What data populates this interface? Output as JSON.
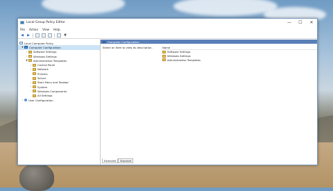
{
  "window": {
    "title": "Local Group Policy Editor",
    "controls": {
      "minimize": "—",
      "maximize": "☐",
      "close": "✕"
    }
  },
  "menu": [
    "File",
    "Action",
    "View",
    "Help"
  ],
  "toolbar": [
    "back",
    "forward",
    "up",
    "show-hide-tree",
    "properties",
    "help",
    "filter"
  ],
  "tree": {
    "root": "Local Computer Policy",
    "computer_config": "Computer Configuration",
    "software_settings": "Software Settings",
    "windows_settings": "Windows Settings",
    "admin_templates": "Administrative Templates",
    "control_panel": "Control Panel",
    "network": "Network",
    "printers": "Printers",
    "server": "Server",
    "start_menu": "Start Menu and Taskbar",
    "system": "System",
    "windows_components": "Windows Components",
    "all_settings": "All Settings",
    "user_config": "User Configuration"
  },
  "right_pane": {
    "header": "Computer Configuration",
    "description": "Select an item to view its description.",
    "column_name": "Name",
    "items": [
      "Software Settings",
      "Windows Settings",
      "Administrative Templates"
    ],
    "tabs": [
      "Extended",
      "Standard"
    ]
  }
}
